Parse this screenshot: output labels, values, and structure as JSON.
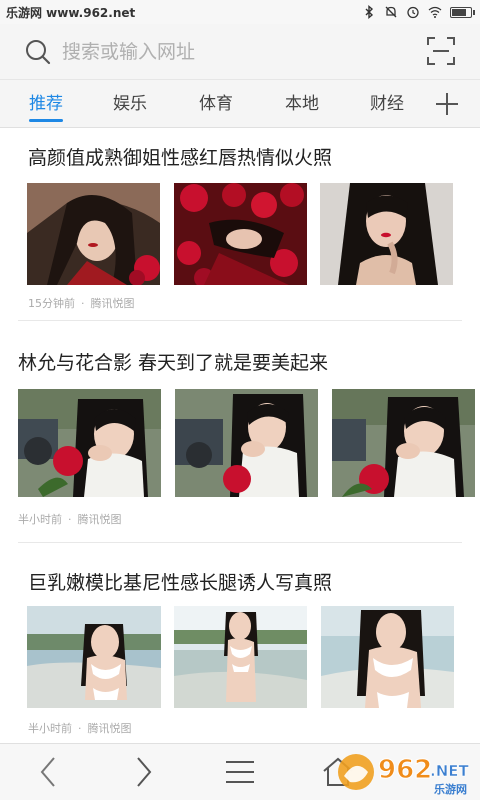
{
  "watermark_top": "乐游网 www.962.net",
  "status_bar": {
    "icons": [
      "bluetooth-icon",
      "mute-icon",
      "alarm-icon",
      "wifi-icon",
      "battery-icon"
    ],
    "battery_level": 0.85
  },
  "search": {
    "placeholder": "搜索或输入网址"
  },
  "tabs": [
    {
      "label": "推荐",
      "active": true
    },
    {
      "label": "娱乐",
      "active": false
    },
    {
      "label": "体育",
      "active": false
    },
    {
      "label": "本地",
      "active": false
    },
    {
      "label": "财经",
      "active": false
    }
  ],
  "articles": [
    {
      "title": "高颜值成熟御姐性感红唇热情似火照",
      "time": "15分钟前",
      "source": "腾讯悦图"
    },
    {
      "title": "林允与花合影 春天到了就是要美起来",
      "time": "半小时前",
      "source": "腾讯悦图"
    },
    {
      "title": "巨乳嫩模比基尼性感长腿诱人写真照",
      "time": "半小时前",
      "source": "腾讯悦图"
    }
  ],
  "bottom_nav": [
    "back-icon",
    "forward-icon",
    "menu-icon",
    "home-icon"
  ],
  "watermark_logo": {
    "number": "962",
    "suffix": ".NET",
    "caption": "乐游网"
  },
  "colors": {
    "accent": "#1e88e5",
    "rose": "#c8102e"
  }
}
